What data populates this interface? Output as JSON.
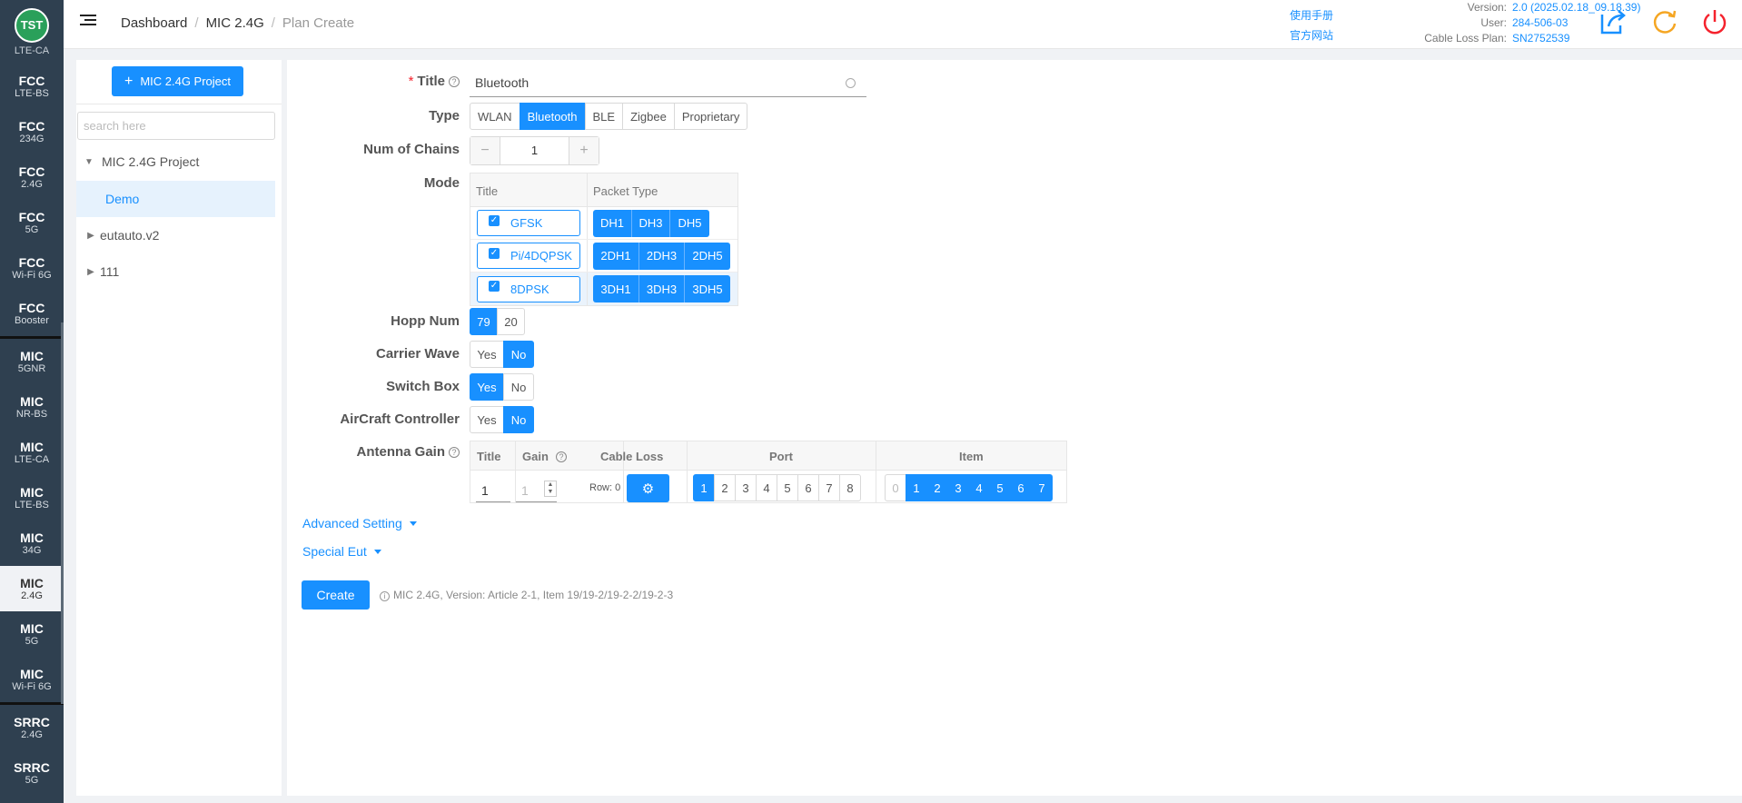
{
  "logo": {
    "text": "TST",
    "sub": "LTE-CA"
  },
  "nav": [
    {
      "t": "FCC",
      "s": "LTE-BS"
    },
    {
      "t": "FCC",
      "s": "234G"
    },
    {
      "t": "FCC",
      "s": "2.4G"
    },
    {
      "t": "FCC",
      "s": "5G"
    },
    {
      "t": "FCC",
      "s": "Wi-Fi 6G"
    },
    {
      "t": "FCC",
      "s": "Booster"
    },
    {
      "t": "MIC",
      "s": "5GNR"
    },
    {
      "t": "MIC",
      "s": "NR-BS"
    },
    {
      "t": "MIC",
      "s": "LTE-CA"
    },
    {
      "t": "MIC",
      "s": "LTE-BS"
    },
    {
      "t": "MIC",
      "s": "34G"
    },
    {
      "t": "MIC",
      "s": "2.4G"
    },
    {
      "t": "MIC",
      "s": "5G"
    },
    {
      "t": "MIC",
      "s": "Wi-Fi 6G"
    },
    {
      "t": "SRRC",
      "s": "2.4G"
    },
    {
      "t": "SRRC",
      "s": "5G"
    }
  ],
  "header": {
    "breadcrumb": [
      "Dashboard",
      "MIC 2.4G",
      "Plan Create"
    ],
    "links": [
      "使用手册",
      "官方网站"
    ],
    "meta": [
      {
        "k": "Version:",
        "v": "2.0 (2025.02.18_09.18.39)"
      },
      {
        "k": "User:",
        "v": "284-506-03"
      },
      {
        "k": "Cable Loss Plan:",
        "v": "SN2752539"
      }
    ]
  },
  "tree": {
    "add_label": "MIC 2.4G Project",
    "search_placeholder": "search here",
    "nodes": [
      {
        "label": "MIC 2.4G Project"
      },
      {
        "label": "Demo"
      },
      {
        "label": "eutauto.v2"
      },
      {
        "label": "111"
      }
    ]
  },
  "form": {
    "labels": {
      "title": "Title",
      "type": "Type",
      "chains": "Num of Chains",
      "mode": "Mode",
      "hopp": "Hopp Num",
      "carrier": "Carrier Wave",
      "switchbox": "Switch Box",
      "aircraft": "AirCraft Controller",
      "antenna": "Antenna Gain"
    },
    "title_value": "Bluetooth",
    "types": [
      "WLAN",
      "Bluetooth",
      "BLE",
      "Zigbee",
      "Proprietary"
    ],
    "type_selected": "Bluetooth",
    "chains": "1",
    "mode_headers": [
      "Title",
      "Packet Type"
    ],
    "modes": [
      {
        "title": "GFSK",
        "packets": [
          "DH1",
          "DH3",
          "DH5"
        ]
      },
      {
        "title": "Pi/4DQPSK",
        "packets": [
          "2DH1",
          "2DH3",
          "2DH5"
        ]
      },
      {
        "title": "8DPSK",
        "packets": [
          "3DH1",
          "3DH3",
          "3DH5"
        ]
      }
    ],
    "hopp": [
      "79",
      "20"
    ],
    "yes": "Yes",
    "no": "No",
    "antenna_headers": [
      "Title",
      "Gain",
      "Cable Loss",
      "Port",
      "Item"
    ],
    "antenna_title": "1",
    "antenna_gain": "1",
    "row_text": "Row: 0",
    "ports": [
      "1",
      "2",
      "3",
      "4",
      "5",
      "6",
      "7",
      "8"
    ],
    "items": [
      "0",
      "1",
      "2",
      "3",
      "4",
      "5",
      "6",
      "7"
    ],
    "advanced": "Advanced Setting",
    "special": "Special Eut",
    "create": "Create",
    "note": "MIC 2.4G, Version: Article 2-1, Item 19/19-2/19-2-2/19-2-3"
  },
  "colors": {
    "accent": "#1890ff",
    "sidebar": "#2f4050",
    "logo": "#2aa05a"
  }
}
